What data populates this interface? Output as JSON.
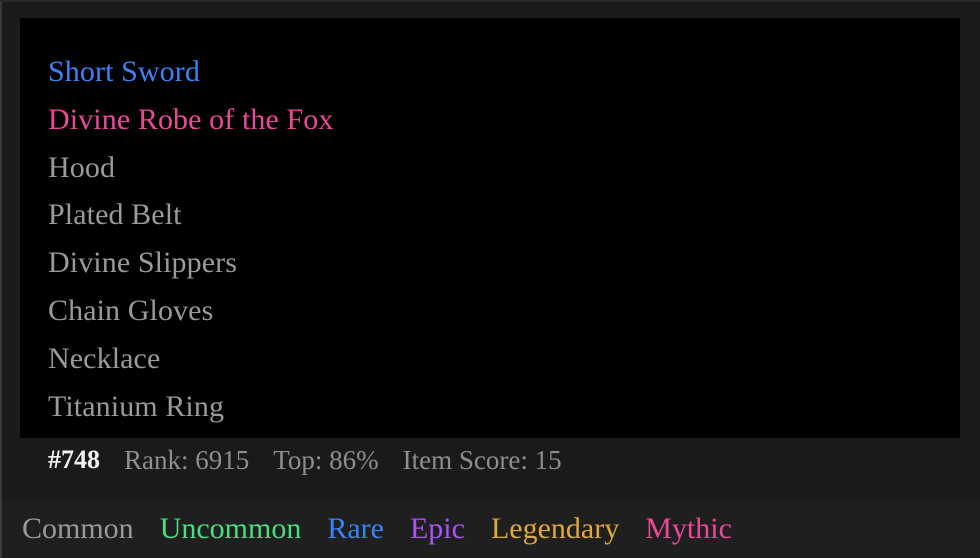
{
  "card": {
    "background": "#1b1b1b",
    "panel_background": "#000000"
  },
  "rarity_colors": {
    "common": "#9a9a9a",
    "uncommon": "#4ade80",
    "rare": "#3b82f6",
    "epic": "#a855f7",
    "legendary": "#e0a93a",
    "mythic": "#ec4899"
  },
  "items": [
    {
      "name": "Short Sword",
      "rarity": "rare"
    },
    {
      "name": "Divine Robe of the Fox",
      "rarity": "mythic"
    },
    {
      "name": "Hood",
      "rarity": "common"
    },
    {
      "name": "Plated Belt",
      "rarity": "common"
    },
    {
      "name": "Divine Slippers",
      "rarity": "common"
    },
    {
      "name": "Chain Gloves",
      "rarity": "common"
    },
    {
      "name": "Necklace",
      "rarity": "common"
    },
    {
      "name": "Titanium Ring",
      "rarity": "common"
    }
  ],
  "stats": {
    "token_id": "#748",
    "rank": "Rank: 6915",
    "top_percent": "Top: 86%",
    "item_score": "Item Score: 15"
  },
  "legend": [
    {
      "label": "Common",
      "rarity": "common"
    },
    {
      "label": "Uncommon",
      "rarity": "uncommon"
    },
    {
      "label": "Rare",
      "rarity": "rare"
    },
    {
      "label": "Epic",
      "rarity": "epic"
    },
    {
      "label": "Legendary",
      "rarity": "legendary"
    },
    {
      "label": "Mythic",
      "rarity": "mythic"
    }
  ]
}
